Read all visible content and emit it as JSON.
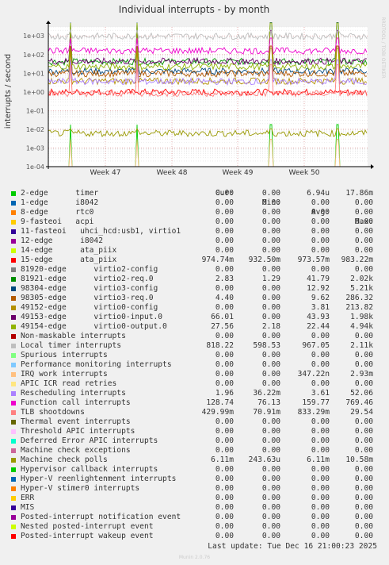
{
  "chart_data": {
    "type": "line",
    "title": "Individual interrupts - by month",
    "ylabel": "interrupts / second",
    "side_label": "RRDTOOL / TOBI OETIKER",
    "y_scale": "log",
    "ylim": [
      0.0001,
      3000
    ],
    "y_ticks": [
      "1e+03",
      "1e+02",
      "1e+01",
      "1e+00",
      "1e-01",
      "1e-02",
      "1e-03",
      "1e-04"
    ],
    "x_ticks": [
      "Week 47",
      "Week 48",
      "Week 49",
      "Week 50"
    ],
    "grid": true,
    "columns": [
      "Cur:",
      "Min:",
      "Avg:",
      "Max:"
    ],
    "series": [
      {
        "name": "2-edge      timer",
        "color": "#00cc00",
        "cur": "0.00",
        "min": "0.00",
        "avg": "6.94u",
        "max": "17.86m"
      },
      {
        "name": "1-edge      i8042",
        "color": "#0066b3",
        "cur": "0.00",
        "min": "0.00",
        "avg": "0.00",
        "max": "0.00"
      },
      {
        "name": "8-edge      rtc0",
        "color": "#ff8000",
        "cur": "0.00",
        "min": "0.00",
        "avg": "0.00",
        "max": "0.00"
      },
      {
        "name": "9-fasteoi   acpi",
        "color": "#ffcc00",
        "cur": "0.00",
        "min": "0.00",
        "avg": "0.00",
        "max": "0.00"
      },
      {
        "name": "11-fasteoi   uhci_hcd:usb1, virtio1",
        "color": "#330099",
        "cur": "0.00",
        "min": "0.00",
        "avg": "0.00",
        "max": "0.00"
      },
      {
        "name": "12-edge      i8042",
        "color": "#990099",
        "cur": "0.00",
        "min": "0.00",
        "avg": "0.00",
        "max": "0.00"
      },
      {
        "name": "14-edge      ata_piix",
        "color": "#ccff00",
        "cur": "0.00",
        "min": "0.00",
        "avg": "0.00",
        "max": "0.00"
      },
      {
        "name": "15-edge      ata_piix",
        "color": "#ff0000",
        "cur": "974.74m",
        "min": "932.50m",
        "avg": "973.57m",
        "max": "983.22m"
      },
      {
        "name": "81920-edge      virtio2-config",
        "color": "#808080",
        "cur": "0.00",
        "min": "0.00",
        "avg": "0.00",
        "max": "0.00"
      },
      {
        "name": "81921-edge      virtio2-req.0",
        "color": "#008f00",
        "cur": "2.83",
        "min": "1.29",
        "avg": "41.79",
        "max": "2.02k"
      },
      {
        "name": "98304-edge      virtio3-config",
        "color": "#00487d",
        "cur": "0.00",
        "min": "0.00",
        "avg": "12.92",
        "max": "5.21k"
      },
      {
        "name": "98305-edge      virtio3-req.0",
        "color": "#b35a00",
        "cur": "4.40",
        "min": "0.00",
        "avg": "9.62",
        "max": "286.32"
      },
      {
        "name": "49152-edge      virtio0-config",
        "color": "#b38f00",
        "cur": "0.00",
        "min": "0.00",
        "avg": "3.81",
        "max": "213.82"
      },
      {
        "name": "49153-edge      virtio0-input.0",
        "color": "#6b006b",
        "cur": "66.01",
        "min": "0.00",
        "avg": "43.93",
        "max": "1.98k"
      },
      {
        "name": "49154-edge      virtio0-output.0",
        "color": "#8fb300",
        "cur": "27.56",
        "min": "2.18",
        "avg": "22.44",
        "max": "4.94k"
      },
      {
        "name": "Non-maskable interrupts",
        "color": "#b30000",
        "cur": "0.00",
        "min": "0.00",
        "avg": "0.00",
        "max": "0.00"
      },
      {
        "name": "Local timer interrupts",
        "color": "#bebebe",
        "cur": "818.22",
        "min": "598.53",
        "avg": "967.05",
        "max": "2.11k"
      },
      {
        "name": "Spurious interrupts",
        "color": "#80ff80",
        "cur": "0.00",
        "min": "0.00",
        "avg": "0.00",
        "max": "0.00"
      },
      {
        "name": "Performance monitoring interrupts",
        "color": "#80c9ff",
        "cur": "0.00",
        "min": "0.00",
        "avg": "0.00",
        "max": "0.00"
      },
      {
        "name": "IRQ work interrupts",
        "color": "#ffc080",
        "cur": "0.00",
        "min": "0.00",
        "avg": "347.22n",
        "max": "2.93m"
      },
      {
        "name": "APIC ICR read retries",
        "color": "#ffe680",
        "cur": "0.00",
        "min": "0.00",
        "avg": "0.00",
        "max": "0.00"
      },
      {
        "name": "Rescheduling interrupts",
        "color": "#aa80ff",
        "cur": "1.96",
        "min": "36.22m",
        "avg": "3.61",
        "max": "52.06"
      },
      {
        "name": "Function call interrupts",
        "color": "#ee00cc",
        "cur": "128.74",
        "min": "76.13",
        "avg": "159.77",
        "max": "769.46"
      },
      {
        "name": "TLB shootdowns",
        "color": "#ff8080",
        "cur": "429.99m",
        "min": "70.91m",
        "avg": "833.29m",
        "max": "29.54"
      },
      {
        "name": "Thermal event interrupts",
        "color": "#666600",
        "cur": "0.00",
        "min": "0.00",
        "avg": "0.00",
        "max": "0.00"
      },
      {
        "name": "Threshold APIC interrupts",
        "color": "#ffbfff",
        "cur": "0.00",
        "min": "0.00",
        "avg": "0.00",
        "max": "0.00"
      },
      {
        "name": "Deferred Error APIC interrupts",
        "color": "#00ffcc",
        "cur": "0.00",
        "min": "0.00",
        "avg": "0.00",
        "max": "0.00"
      },
      {
        "name": "Machine check exceptions",
        "color": "#cc6699",
        "cur": "0.00",
        "min": "0.00",
        "avg": "0.00",
        "max": "0.00"
      },
      {
        "name": "Machine check polls",
        "color": "#999900",
        "cur": "6.11m",
        "min": "243.63u",
        "avg": "6.11m",
        "max": "10.58m"
      },
      {
        "name": "Hypervisor callback interrupts",
        "color": "#00cc00",
        "cur": "0.00",
        "min": "0.00",
        "avg": "0.00",
        "max": "0.00"
      },
      {
        "name": "Hyper-V reenlightenment interrupts",
        "color": "#0066b3",
        "cur": "0.00",
        "min": "0.00",
        "avg": "0.00",
        "max": "0.00"
      },
      {
        "name": "Hyper-V stimer0 interrupts",
        "color": "#ff8000",
        "cur": "0.00",
        "min": "0.00",
        "avg": "0.00",
        "max": "0.00"
      },
      {
        "name": "ERR",
        "color": "#ffcc00",
        "cur": "0.00",
        "min": "0.00",
        "avg": "0.00",
        "max": "0.00"
      },
      {
        "name": "MIS",
        "color": "#330099",
        "cur": "0.00",
        "min": "0.00",
        "avg": "0.00",
        "max": "0.00"
      },
      {
        "name": "Posted-interrupt notification event",
        "color": "#990099",
        "cur": "0.00",
        "min": "0.00",
        "avg": "0.00",
        "max": "0.00"
      },
      {
        "name": "Nested posted-interrupt event",
        "color": "#ccff00",
        "cur": "0.00",
        "min": "0.00",
        "avg": "0.00",
        "max": "0.00"
      },
      {
        "name": "Posted-interrupt wakeup event",
        "color": "#ff0000",
        "cur": "0.00",
        "min": "0.00",
        "avg": "0.00",
        "max": "0.00"
      }
    ],
    "last_update": "Last update: Tue Dec 16 21:00:23 2025",
    "footer": "Munin 2.0.76"
  }
}
